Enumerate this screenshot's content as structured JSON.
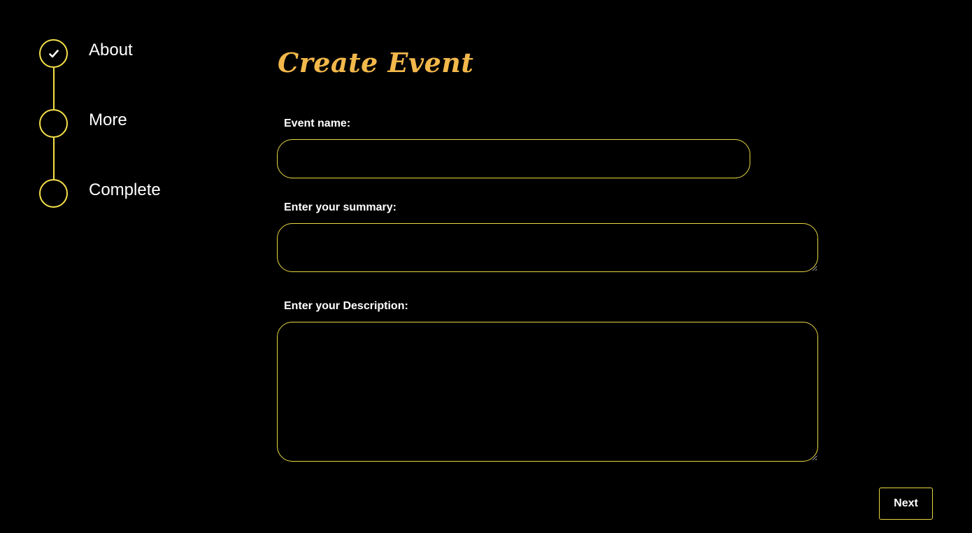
{
  "stepper": {
    "steps": [
      {
        "label": "About",
        "completed": true,
        "icon": "checkmark-icon"
      },
      {
        "label": "More",
        "completed": false
      },
      {
        "label": "Complete",
        "completed": false
      }
    ]
  },
  "form": {
    "title": "Create Event",
    "event_name": {
      "label": "Event name:",
      "value": ""
    },
    "summary": {
      "label": "Enter your summary:",
      "value": ""
    },
    "description": {
      "label": "Enter your Description:",
      "value": ""
    }
  },
  "actions": {
    "next_label": "Next"
  },
  "colors": {
    "background": "#000000",
    "accent": "#f5e04a",
    "title": "#f2b84b",
    "text": "#ffffff"
  }
}
